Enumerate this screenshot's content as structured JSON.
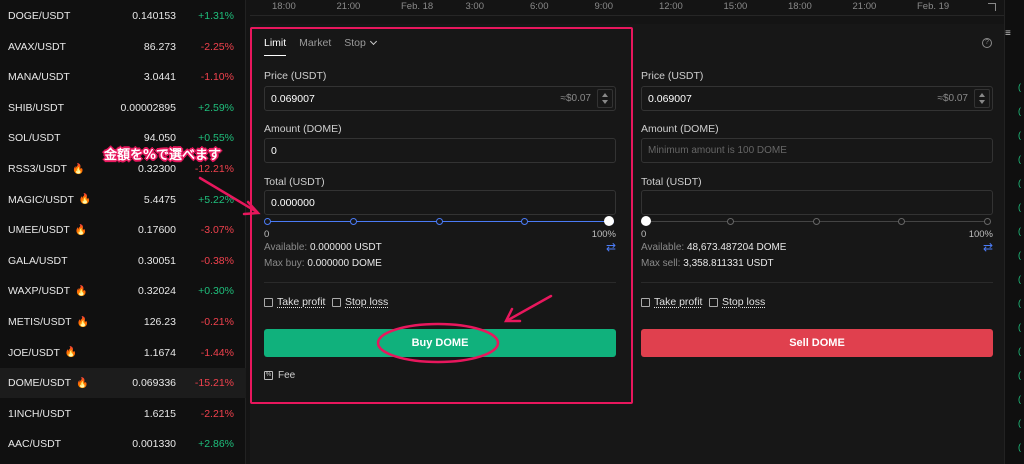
{
  "markets": [
    {
      "pair": "DOGE/USDT",
      "hot": false,
      "price": "0.140153",
      "change": "+1.31%",
      "dir": "up"
    },
    {
      "pair": "AVAX/USDT",
      "hot": false,
      "price": "86.273",
      "change": "-2.25%",
      "dir": "down"
    },
    {
      "pair": "MANA/USDT",
      "hot": false,
      "price": "3.0441",
      "change": "-1.10%",
      "dir": "down"
    },
    {
      "pair": "SHIB/USDT",
      "hot": false,
      "price": "0.00002895",
      "change": "+2.59%",
      "dir": "up"
    },
    {
      "pair": "SOL/USDT",
      "hot": false,
      "price": "94.050",
      "change": "+0.55%",
      "dir": "up"
    },
    {
      "pair": "RSS3/USDT",
      "hot": true,
      "price": "0.32300",
      "change": "-12.21%",
      "dir": "down"
    },
    {
      "pair": "MAGIC/USDT",
      "hot": true,
      "price": "5.4475",
      "change": "+5.22%",
      "dir": "up"
    },
    {
      "pair": "UMEE/USDT",
      "hot": true,
      "price": "0.17600",
      "change": "-3.07%",
      "dir": "down"
    },
    {
      "pair": "GALA/USDT",
      "hot": false,
      "price": "0.30051",
      "change": "-0.38%",
      "dir": "down"
    },
    {
      "pair": "WAXP/USDT",
      "hot": true,
      "price": "0.32024",
      "change": "+0.30%",
      "dir": "up"
    },
    {
      "pair": "METIS/USDT",
      "hot": true,
      "price": "126.23",
      "change": "-0.21%",
      "dir": "down"
    },
    {
      "pair": "JOE/USDT",
      "hot": true,
      "price": "1.1674",
      "change": "-1.44%",
      "dir": "down"
    },
    {
      "pair": "DOME/USDT",
      "hot": true,
      "price": "0.069336",
      "change": "-15.21%",
      "dir": "down",
      "active": true
    },
    {
      "pair": "1INCH/USDT",
      "hot": false,
      "price": "1.6215",
      "change": "-2.21%",
      "dir": "down"
    },
    {
      "pair": "AAC/USDT",
      "hot": false,
      "price": "0.001330",
      "change": "+2.86%",
      "dir": "up"
    }
  ],
  "timeline": [
    "18:00",
    "21:00",
    "Feb. 18",
    "3:00",
    "6:00",
    "9:00",
    "12:00",
    "15:00",
    "18:00",
    "21:00",
    "Feb. 19"
  ],
  "tabs": {
    "limit": "Limit",
    "market": "Market",
    "stop": "Stop"
  },
  "buy": {
    "price_label": "Price (USDT)",
    "price_value": "0.069007",
    "price_suffix": "≈$0.07",
    "amount_label": "Amount (DOME)",
    "amount_value": "0",
    "total_label": "Total (USDT)",
    "total_value": "0.000000",
    "slider_percent": 100,
    "pct_min": "0",
    "pct_max": "100%",
    "available_label": "Available:",
    "available_value": "0.000000 USDT",
    "max_label": "Max buy:",
    "max_value": "0.000000 DOME",
    "take_profit": "Take profit",
    "stop_loss": "Stop loss",
    "button": "Buy DOME",
    "fee": "Fee"
  },
  "sell": {
    "price_label": "Price (USDT)",
    "price_value": "0.069007",
    "price_suffix": "≈$0.07",
    "amount_label": "Amount (DOME)",
    "amount_placeholder": "Minimum amount is 100 DOME",
    "total_label": "Total (USDT)",
    "slider_percent": 0,
    "pct_min": "0",
    "pct_max": "100%",
    "available_label": "Available:",
    "available_value": "48,673.487204 DOME",
    "max_label": "Max sell:",
    "max_value": "3,358.811331 USDT",
    "take_profit": "Take profit",
    "stop_loss": "Stop loss",
    "button": "Sell DOME"
  },
  "annotation": {
    "text": "金額を%で選べます"
  },
  "colors": {
    "up": "#1fbf7c",
    "down": "#f0414d",
    "buy": "#10b17c",
    "sell": "#e0404e",
    "accent": "#4b7bf5",
    "annotation": "#e8175d"
  }
}
